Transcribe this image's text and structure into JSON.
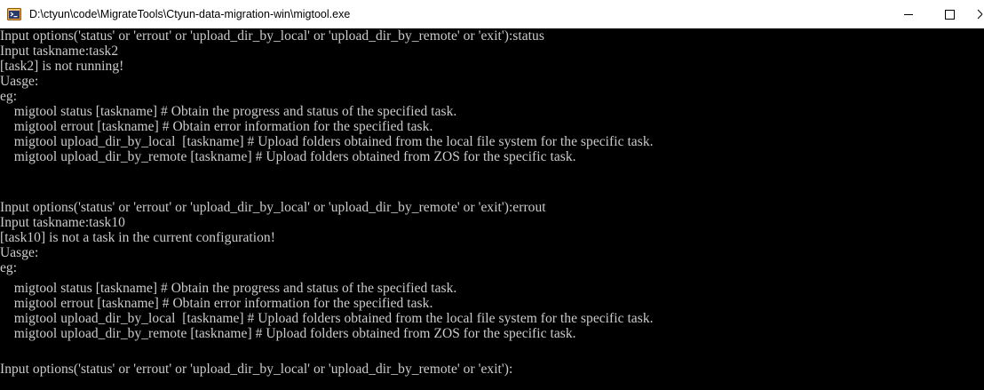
{
  "window": {
    "title": "D:\\ctyun\\code\\MigrateTools\\Ctyun-data-migration-win\\migtool.exe",
    "icon": "console-app-icon",
    "controls": [
      "minimize-icon",
      "maximize-icon",
      "close-icon"
    ]
  },
  "colors": {
    "console_background": "#000000",
    "console_text": "#cccccc",
    "titlebar_background": "#ffffff"
  },
  "console": {
    "lines": [
      "Input options('status' or 'errout' or 'upload_dir_by_local' or 'upload_dir_by_remote' or 'exit'):status",
      "Input taskname:task2",
      "[task2] is not running!",
      "Uasge:",
      "eg:",
      "    migtool status [taskname] # Obtain the progress and status of the specified task.",
      "    migtool errout [taskname] # Obtain error information for the specified task.",
      "    migtool upload_dir_by_local  [taskname] # Upload folders obtained from the local file system for the specific task.",
      "    migtool upload_dir_by_remote [taskname] # Upload folders obtained from ZOS for the specific task.",
      "",
      "Input options('status' or 'errout' or 'upload_dir_by_local' or 'upload_dir_by_remote' or 'exit'):errout",
      "Input taskname:task10",
      "[task10] is not a task in the current configuration!",
      "Uasge:",
      "eg:",
      "    migtool status [taskname] # Obtain the progress and status of the specified task.",
      "    migtool errout [taskname] # Obtain error information for the specified task.",
      "    migtool upload_dir_by_local  [taskname] # Upload folders obtained from the local file system for the specific task.",
      "    migtool upload_dir_by_remote [taskname] # Upload folders obtained from ZOS for the specific task.",
      "",
      "Input options('status' or 'errout' or 'upload_dir_by_local' or 'upload_dir_by_remote' or 'exit'):"
    ]
  }
}
